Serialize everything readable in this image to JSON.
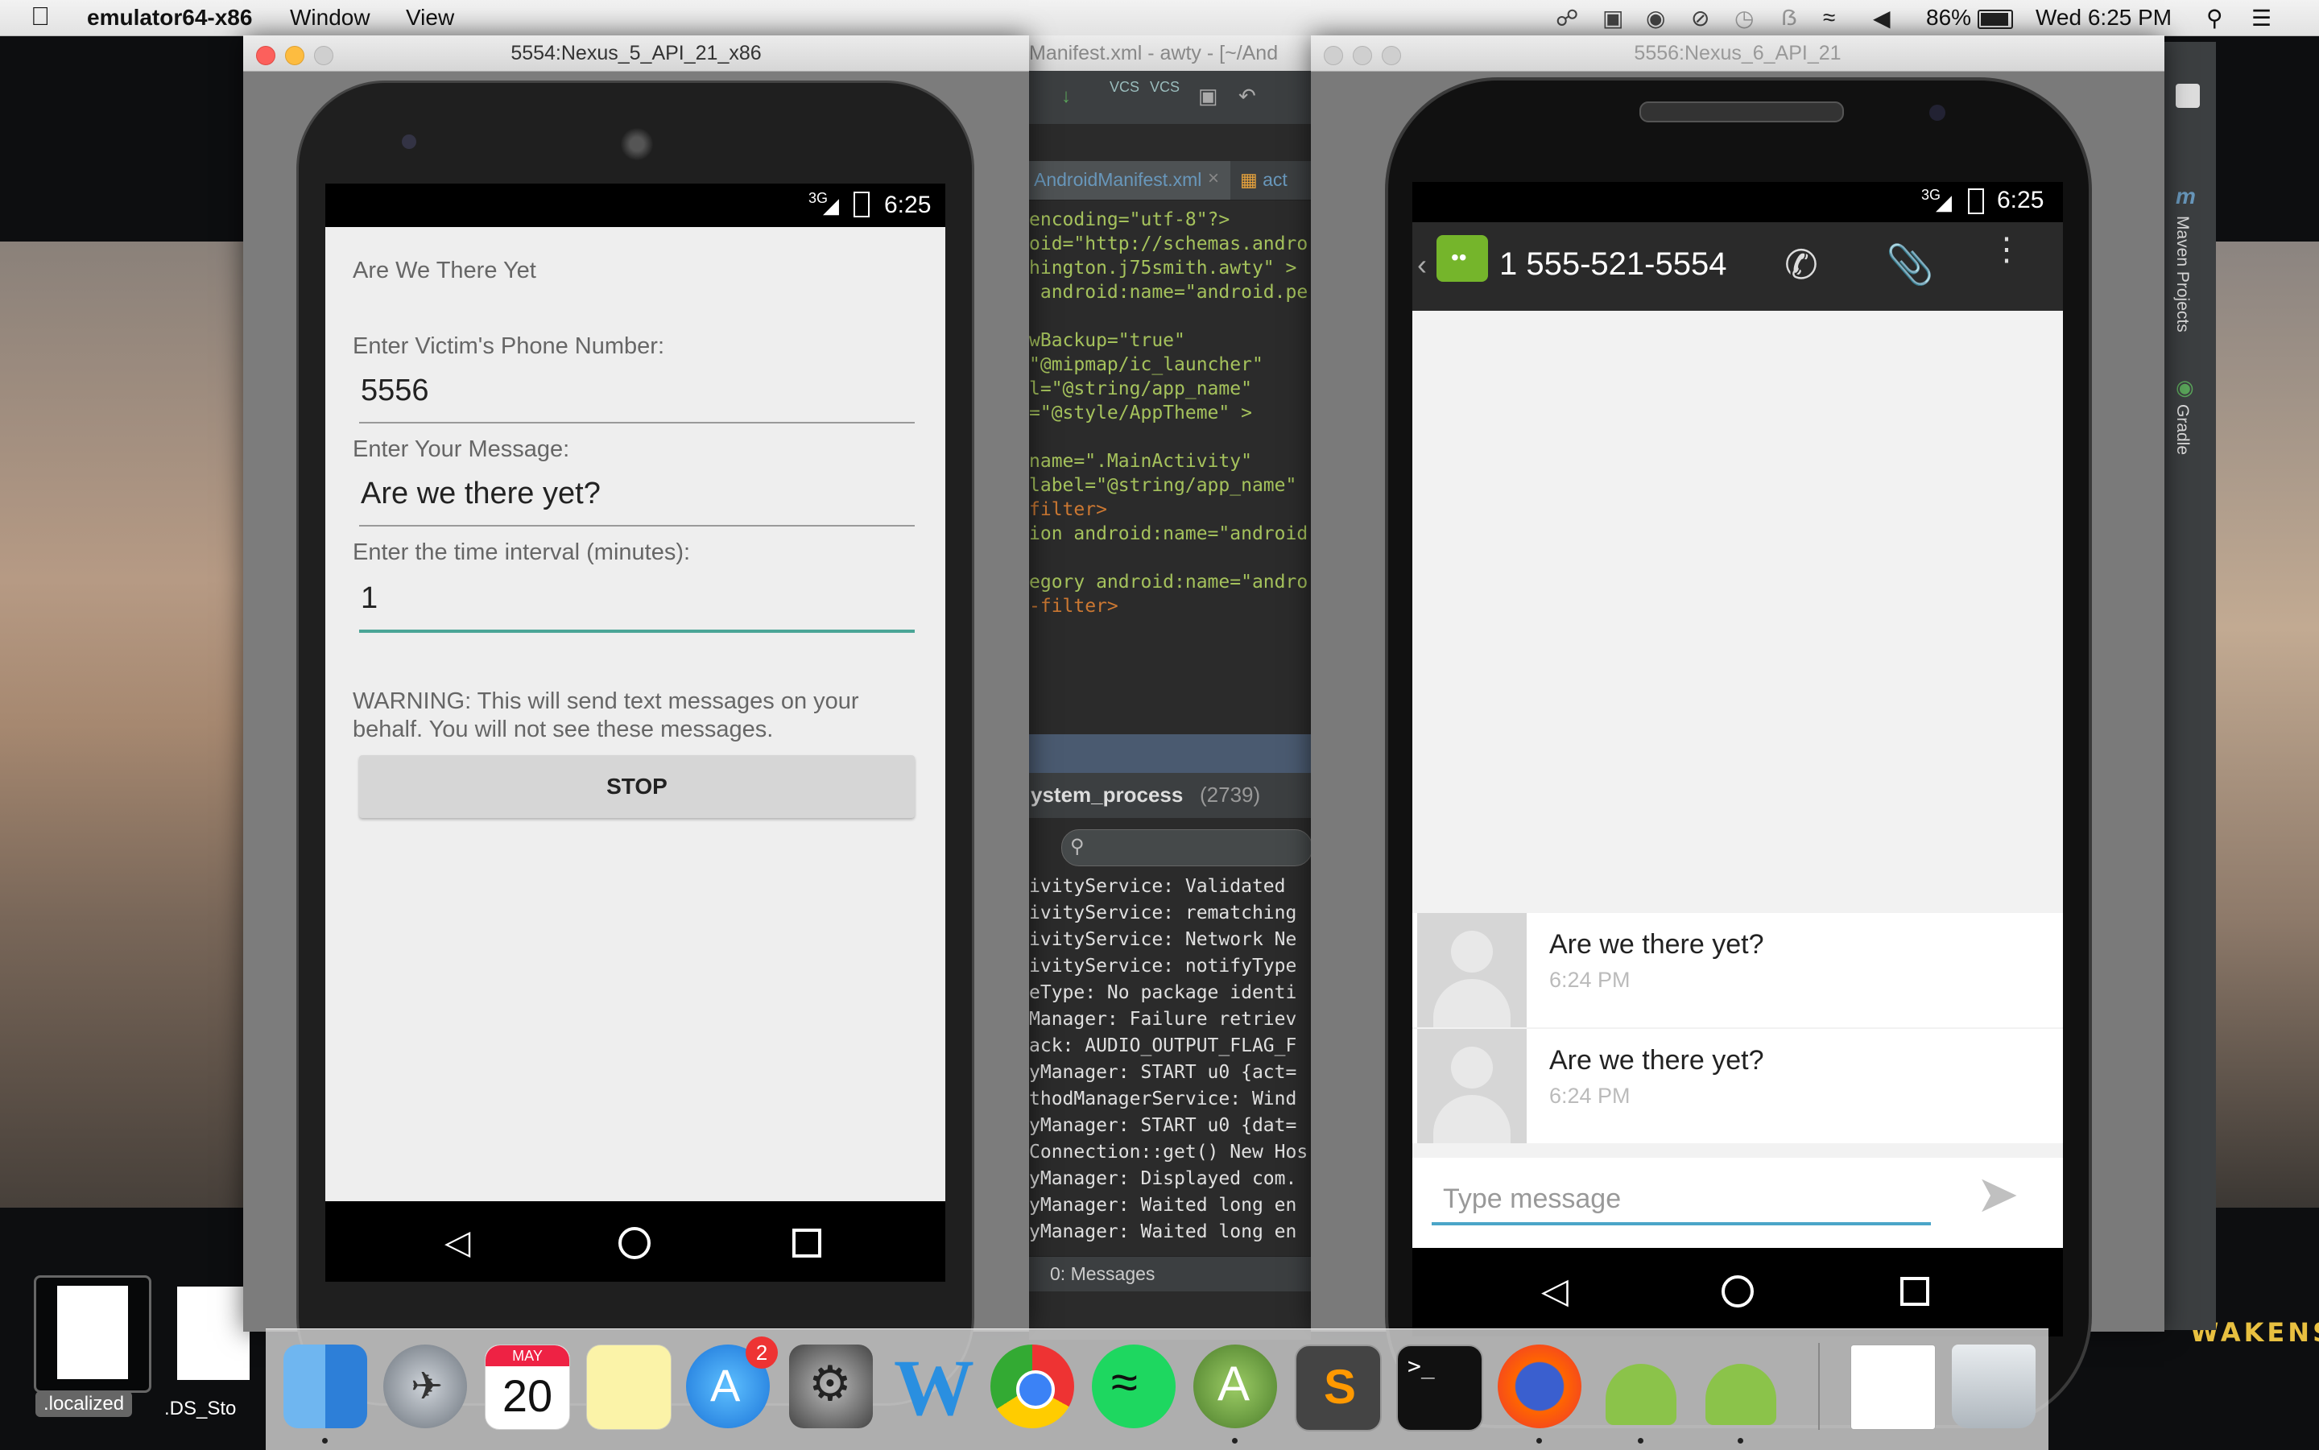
{
  "menubar": {
    "app_name": "emulator64-x86",
    "menus": [
      "Window",
      "View"
    ],
    "battery": "86%",
    "clock": "Wed 6:25 PM"
  },
  "emulator1": {
    "title": "5554:Nexus_5_API_21_x86",
    "status_time": "6:25",
    "signal": "3G",
    "app_title": "Are We There Yet",
    "phone_label": "Enter Victim's Phone Number:",
    "phone_value": "5556",
    "message_label": "Enter Your Message:",
    "message_value": "Are we there yet?",
    "interval_label": "Enter the time interval (minutes):",
    "interval_value": "1",
    "warning": "WARNING: This will send text messages on your behalf. You will not see these messages.",
    "button_label": "STOP"
  },
  "ide": {
    "title": "Manifest.xml - awty - [~/And",
    "tab_label": "AndroidManifest.xml",
    "tab2_label": "act",
    "code_lines": [
      "encoding=\"utf-8\"?>",
      "oid=\"http://schemas.andro",
      "hington.j75smith.awty\" >",
      " android:name=\"android.pe",
      "",
      "wBackup=\"true\"",
      "\"@mipmap/ic_launcher\"",
      "l=\"@string/app_name\"",
      "=\"@style/AppTheme\" >",
      "",
      "name=\".MainActivity\"",
      "label=\"@string/app_name\" ",
      "filter>",
      "ion android:name=\"android",
      "",
      "egory android:name=\"andro",
      "-filter>"
    ],
    "process": "ystem_process",
    "process_pid": "(2739)",
    "log_lines": [
      "ivityService: Validated",
      "ivityService: rematching",
      "ivityService: Network Ne",
      "ivityService: notifyType",
      "eType: No package identi",
      "Manager: Failure retriev",
      "ack: AUDIO_OUTPUT_FLAG_F",
      "yManager: START u0 {act=",
      "thodManagerService: Wind",
      "yManager: START u0 {dat=",
      "Connection::get() New Hos",
      "yManager: Displayed com.",
      "yManager: Waited long en",
      "yManager: Waited long en"
    ],
    "bottom_tab": "0: Messages",
    "side_tab1": "Maven Projects",
    "side_tab2": "Gradle"
  },
  "emulator2": {
    "title": "5556:Nexus_6_API_21",
    "status_time": "6:25",
    "signal": "3G",
    "contact": "1 555-521-5554",
    "messages": [
      {
        "text": "Are we there yet?",
        "time": "6:24 PM"
      },
      {
        "text": "Are we there yet?",
        "time": "6:24 PM"
      }
    ],
    "input_placeholder": "Type message"
  },
  "desktop": {
    "file1": ".localized",
    "file2": ".DS_Sto",
    "calendar_month": "MAY",
    "calendar_day": "20",
    "appstore_badge": "2",
    "sw_text": "WAKENS"
  },
  "colors": {
    "accent_teal": "#4aa596",
    "message_green": "#75b52b"
  }
}
